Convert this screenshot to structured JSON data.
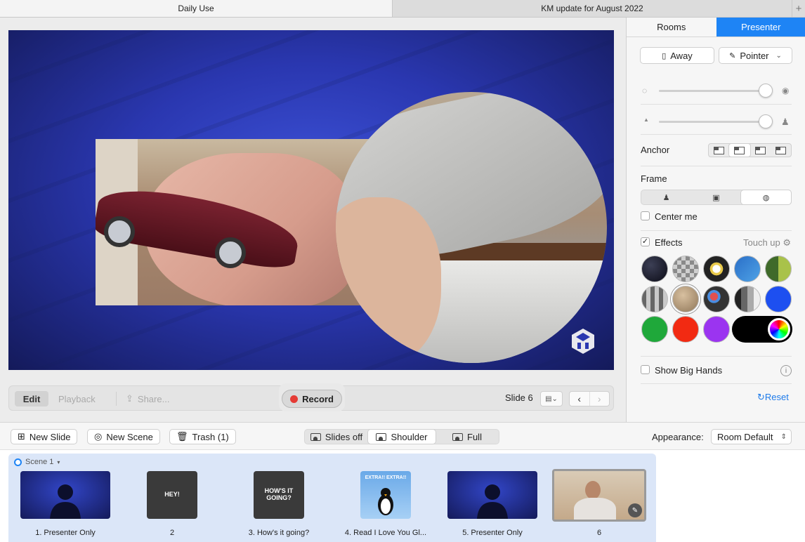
{
  "tabs": [
    {
      "label": "Daily Use"
    },
    {
      "label": "KM update for August 2022"
    }
  ],
  "tab_add_label": "+",
  "toolbar": {
    "edit": "Edit",
    "playback": "Playback",
    "share": "Share...",
    "record": "Record",
    "slide": "Slide 6"
  },
  "panel": {
    "tabs": [
      "Rooms",
      "Presenter"
    ],
    "active_tab": "Presenter",
    "away": "Away",
    "pointer": "Pointer",
    "anchor": "Anchor",
    "frame": "Frame",
    "center_me": "Center me",
    "effects": "Effects",
    "touch_up": "Touch up",
    "show_big_hands": "Show Big Hands",
    "reset": "Reset",
    "opacity_level": 0.95,
    "size_level": 0.95
  },
  "bottombar": {
    "new_slide": "New Slide",
    "new_scene": "New Scene",
    "trash": "Trash (1)",
    "slides_off": "Slides off",
    "shoulder": "Shoulder",
    "full": "Full",
    "appearance_label": "Appearance:",
    "appearance_value": "Room Default"
  },
  "scene": {
    "label": "Scene 1",
    "slides": [
      {
        "caption": "1. Presenter Only",
        "kind": "presenter",
        "text": ""
      },
      {
        "caption": "2",
        "kind": "dark",
        "text": "HEY!"
      },
      {
        "caption": "3. How's it going?",
        "kind": "dark",
        "text": "HOW'S IT GOING?"
      },
      {
        "caption": "4. Read I Love You Gl...",
        "kind": "extra",
        "text": "EXTRA!! EXTRA!!"
      },
      {
        "caption": "5. Presenter Only",
        "kind": "presenter",
        "text": ""
      },
      {
        "caption": "6",
        "kind": "photo",
        "text": ""
      }
    ]
  },
  "colors": {
    "accent": "#1e84f5",
    "record": "#e53b35",
    "stage_blue": "#2a37b0"
  }
}
